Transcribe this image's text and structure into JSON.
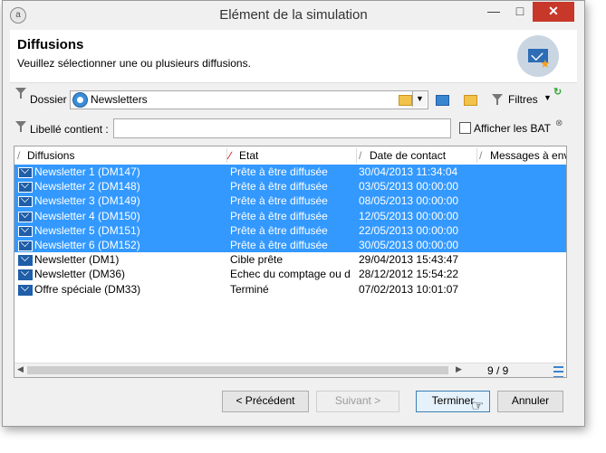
{
  "window": {
    "title": "Elément de la simulation"
  },
  "header": {
    "title": "Diffusions",
    "subtitle": "Veuillez sélectionner une ou plusieurs diffusions."
  },
  "folder": {
    "label": "Dossier :",
    "value": "Newsletters"
  },
  "toolbar": {
    "filters_label": "Filtres"
  },
  "filter": {
    "label": "Libellé contient :",
    "value": "",
    "show_bat_label": "Afficher les BAT",
    "show_bat_checked": false
  },
  "grid": {
    "columns": [
      "Diffusions",
      "Etat",
      "Date de contact",
      "Messages à env"
    ],
    "rows": [
      {
        "name": "Newsletter 1 (DM147)",
        "state": "Prête à être diffusée",
        "date": "30/04/2013 11:34:04",
        "selected": true
      },
      {
        "name": "Newsletter 2 (DM148)",
        "state": "Prête à être diffusée",
        "date": "03/05/2013 00:00:00",
        "selected": true
      },
      {
        "name": "Newsletter 3 (DM149)",
        "state": "Prête à être diffusée",
        "date": "08/05/2013 00:00:00",
        "selected": true
      },
      {
        "name": "Newsletter 4 (DM150)",
        "state": "Prête à être diffusée",
        "date": "12/05/2013 00:00:00",
        "selected": true
      },
      {
        "name": "Newsletter 5 (DM151)",
        "state": "Prête à être diffusée",
        "date": "22/05/2013 00:00:00",
        "selected": true
      },
      {
        "name": "Newsletter 6 (DM152)",
        "state": "Prête à être diffusée",
        "date": "30/05/2013 00:00:00",
        "selected": true
      },
      {
        "name": "Newsletter (DM1)",
        "state": "Cible prête",
        "date": "29/04/2013 15:43:47",
        "selected": false
      },
      {
        "name": "Newsletter (DM36)",
        "state": "Echec du comptage ou d.",
        "date": "28/12/2012 15:54:22",
        "selected": false
      },
      {
        "name": "Offre spéciale (DM33)",
        "state": "Terminé",
        "date": "07/02/2013 10:01:07",
        "selected": false
      }
    ],
    "count": "9 / 9"
  },
  "buttons": {
    "previous": "< Précédent",
    "next": "Suivant >",
    "finish": "Terminer",
    "cancel": "Annuler"
  },
  "colors": {
    "selection": "#3399ff",
    "close": "#c7382a"
  }
}
